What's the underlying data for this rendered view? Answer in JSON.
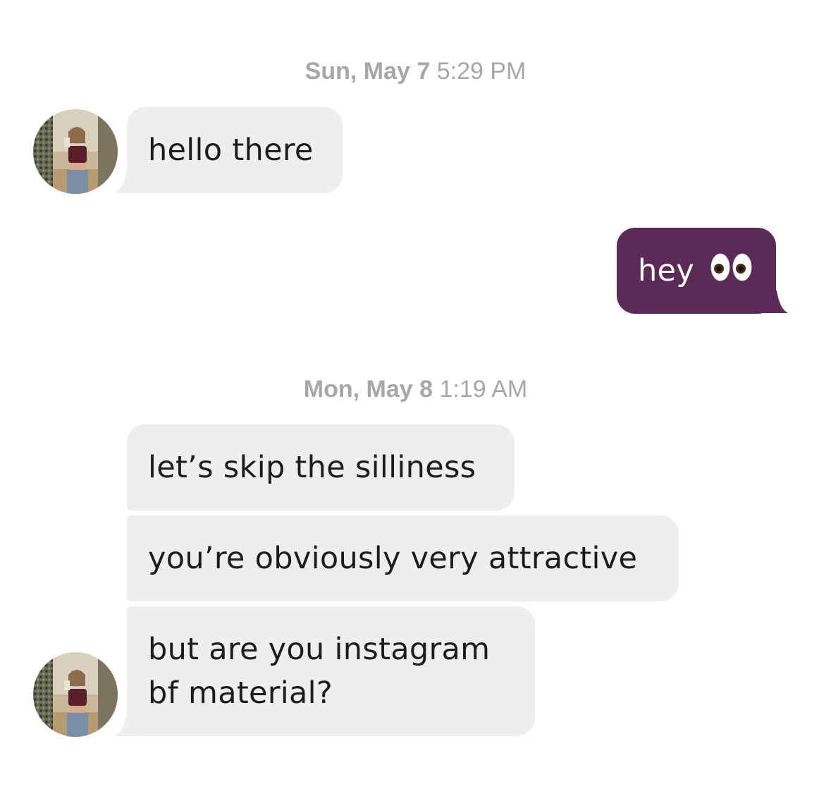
{
  "conversation": {
    "groups": [
      {
        "timestamp_day": "Sun, May 7",
        "timestamp_time": "5:29 PM"
      },
      {
        "timestamp_day": "Mon, May 8",
        "timestamp_time": "1:19 AM"
      }
    ],
    "messages": [
      {
        "sender": "them",
        "text": "hello there"
      },
      {
        "sender": "me",
        "text": "hey",
        "emoji": "eyes-emoji"
      },
      {
        "sender": "them",
        "text": "let’s skip the silliness"
      },
      {
        "sender": "them",
        "text": "you’re obviously very attractive"
      },
      {
        "sender": "them",
        "text_line1": "but are you instagram",
        "text_line2": "bf material?"
      }
    ]
  },
  "colors": {
    "outgoing_bubble": "#5c2a57",
    "incoming_bubble": "#eeeeee",
    "timestamp": "#a7a7a7"
  }
}
